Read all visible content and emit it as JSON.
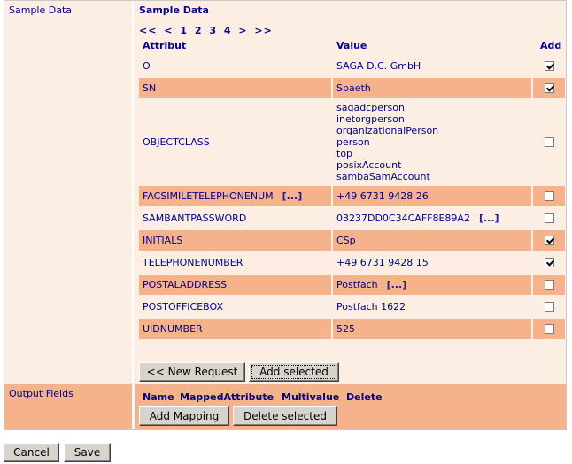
{
  "labels": {
    "sample_data": "Sample Data",
    "output_fields": "Output Fields"
  },
  "sample": {
    "title": "Sample Data",
    "pager": [
      "<<",
      "<",
      "1",
      "2",
      "3",
      "4",
      ">",
      ">>"
    ],
    "headers": {
      "attr": "Attribut",
      "value": "Value",
      "add": "Add"
    },
    "rows": [
      {
        "attr": "O",
        "value": "SAGA D.C. GmbH",
        "checked": true
      },
      {
        "attr": "SN",
        "value": "Spaeth",
        "checked": true
      },
      {
        "attr": "OBJECTCLASS",
        "values": [
          "sagadcperson",
          "inetorgperson",
          "organizationalPerson",
          "person",
          "top",
          "posixAccount",
          "sambaSamAccount"
        ],
        "checked": false
      },
      {
        "attr": "FACSIMILETELEPHONENUM",
        "attr_more": "[...]",
        "value": "+49 6731 9428 26",
        "checked": false
      },
      {
        "attr": "SAMBANTPASSWORD",
        "value": "03237DD0C34CAFF8E89A2",
        "value_more": "[...]",
        "checked": false
      },
      {
        "attr": "INITIALS",
        "value": "CSp",
        "checked": true
      },
      {
        "attr": "TELEPHONENUMBER",
        "value": "+49 6731 9428 15",
        "checked": true
      },
      {
        "attr": "POSTALADDRESS",
        "value": "Postfach",
        "value_more": "[...]",
        "checked": false
      },
      {
        "attr": "POSTOFFICEBOX",
        "value": "Postfach 1622",
        "checked": false
      },
      {
        "attr": "UIDNUMBER",
        "value": "525",
        "checked": false
      }
    ],
    "buttons": {
      "new_request": "<< New Request",
      "add_selected": "Add selected"
    }
  },
  "output": {
    "headers": [
      "Name",
      "MappedAttribute",
      "Multivalue",
      "Delete"
    ],
    "buttons": {
      "add_mapping": "Add Mapping",
      "delete_selected": "Delete selected"
    }
  },
  "footer": {
    "cancel": "Cancel",
    "save": "Save"
  },
  "colors": {
    "panel_light": "#fdeee3",
    "panel_dark": "#f6b28a",
    "text": "#00008b"
  }
}
